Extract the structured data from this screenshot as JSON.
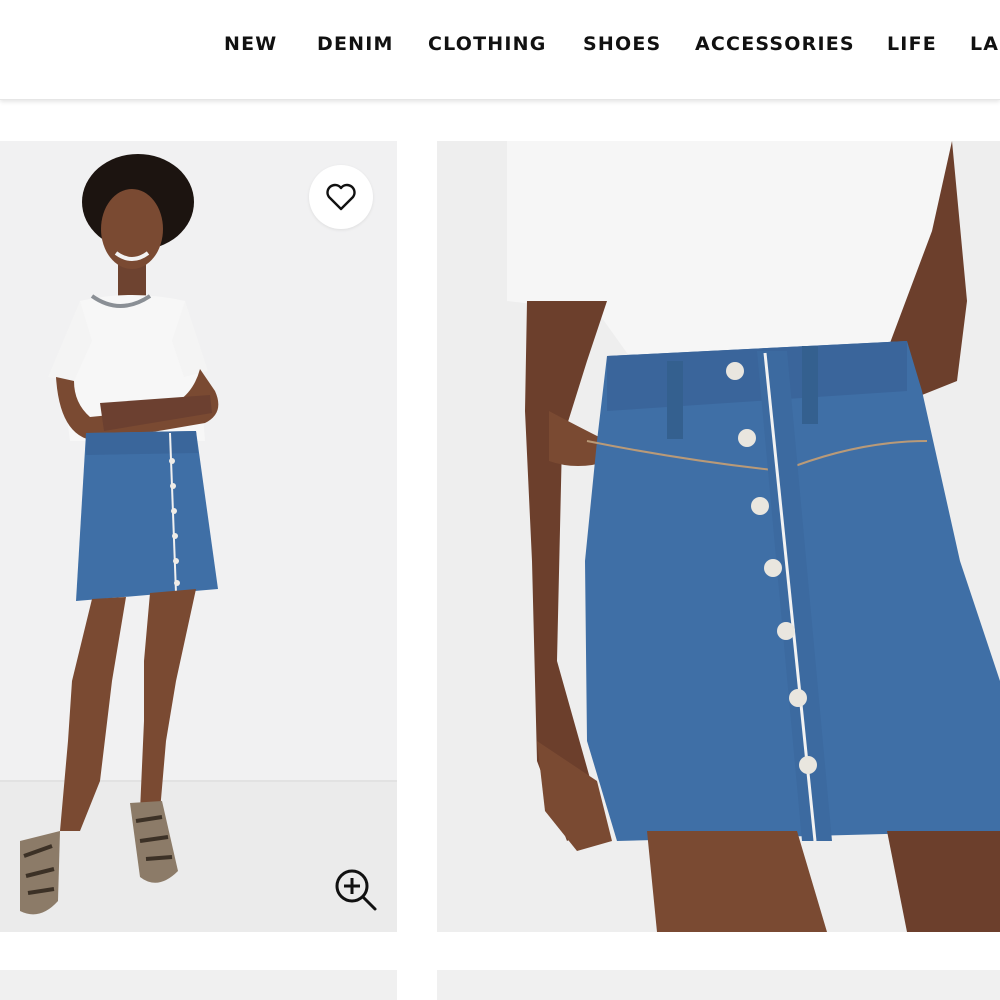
{
  "header": {
    "nav": [
      {
        "label": "NEW"
      },
      {
        "label": "DENIM"
      },
      {
        "label": "CLOTHING"
      },
      {
        "label": "SHOES"
      },
      {
        "label": "ACCESSORIES"
      },
      {
        "label": "LIFE"
      },
      {
        "label": "LA"
      }
    ]
  },
  "gallery": {
    "icons": {
      "wishlist": "heart-icon",
      "zoom": "zoom-in-icon"
    },
    "colors": {
      "denim": "#3f6fa6",
      "tee": "#f7f7f7",
      "skin": "#7a4a32",
      "background": "#f1f1f2"
    }
  }
}
